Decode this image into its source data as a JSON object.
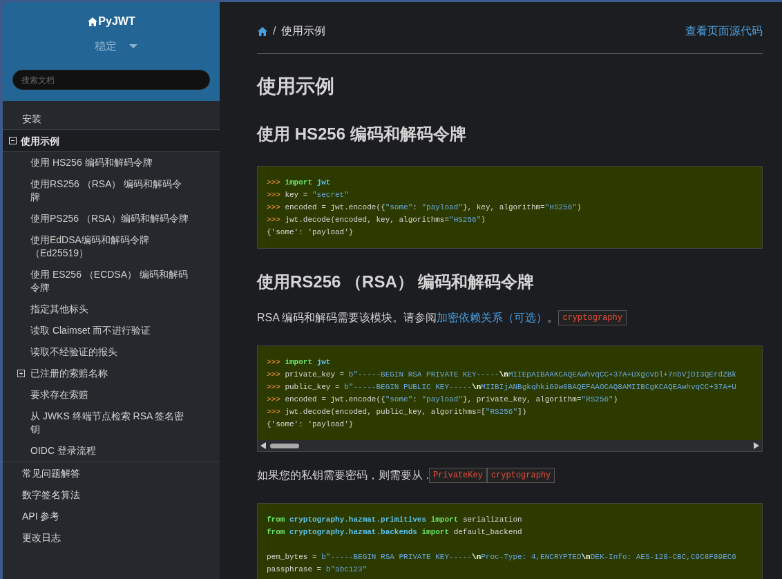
{
  "sidebar": {
    "project": "PyJWT",
    "version": "稳定",
    "search": {
      "placeholder": "搜索文档"
    },
    "items": [
      {
        "label": "安装",
        "selected": false
      },
      {
        "label": "使用示例",
        "selected": true,
        "expanded": true,
        "children": [
          {
            "label": "使用 HS256 编码和解码令牌"
          },
          {
            "label": "使用RS256 （RSA） 编码和解码令牌"
          },
          {
            "label": "使用PS256 （RSA）编码和解码令牌"
          },
          {
            "label": "使用EdDSA编码和解码令牌（Ed25519）"
          },
          {
            "label": "使用 ES256 （ECDSA） 编码和解码令牌"
          },
          {
            "label": "指定其他标头"
          },
          {
            "label": "读取 Claimset 而不进行验证"
          },
          {
            "label": "读取不经验证的报头"
          },
          {
            "label": "已注册的索赔名称",
            "expanded": false
          },
          {
            "label": "要求存在索赔"
          },
          {
            "label": "从 JWKS 终端节点检索 RSA 签名密钥"
          },
          {
            "label": "OIDC 登录流程"
          }
        ]
      },
      {
        "label": "常见问题解答",
        "selected": false
      },
      {
        "label": "数字签名算法",
        "selected": false
      },
      {
        "label": "API 参考",
        "selected": false
      },
      {
        "label": "更改日志",
        "selected": false
      }
    ]
  },
  "breadcrumb": {
    "separator": "/",
    "current": "使用示例",
    "source_link": "查看页面源代码"
  },
  "content": [
    {
      "kind": "h1",
      "text": "使用示例"
    },
    {
      "kind": "h2",
      "text": "使用 HS256 编码和解码令牌"
    },
    {
      "kind": "code",
      "scroll": false,
      "lines": [
        {
          "tokens": [
            {
              "kind": "prompt",
              "text": ">>> "
            },
            {
              "kind": "kw",
              "text": "import "
            },
            {
              "kind": "ns",
              "text": "jwt"
            }
          ]
        },
        {
          "tokens": [
            {
              "kind": "prompt",
              "text": ">>> "
            },
            {
              "kind": "plain",
              "text": "key = "
            },
            {
              "kind": "str",
              "text": "\"secret\""
            }
          ]
        },
        {
          "tokens": [
            {
              "kind": "prompt",
              "text": ">>> "
            },
            {
              "kind": "plain",
              "text": "encoded = jwt.encode({"
            },
            {
              "kind": "str",
              "text": "\"some\""
            },
            {
              "kind": "plain",
              "text": ": "
            },
            {
              "kind": "str",
              "text": "\"payload\""
            },
            {
              "kind": "plain",
              "text": "}, key, algorithm="
            },
            {
              "kind": "str",
              "text": "\"HS256\""
            },
            {
              "kind": "plain",
              "text": ")"
            }
          ]
        },
        {
          "tokens": [
            {
              "kind": "prompt",
              "text": ">>> "
            },
            {
              "kind": "plain",
              "text": "jwt.decode(encoded, key, algorithms="
            },
            {
              "kind": "str",
              "text": "\"HS256\""
            },
            {
              "kind": "plain",
              "text": ")"
            }
          ]
        },
        {
          "tokens": [
            {
              "kind": "plain",
              "text": "{'some': 'payload'}"
            }
          ]
        }
      ]
    },
    {
      "kind": "h2",
      "text": "使用RS256 （RSA） 编码和解码令牌"
    },
    {
      "kind": "para",
      "parts": [
        {
          "kind": "text",
          "text": "RSA 编码和解码需要该模块。请参阅 "
        },
        {
          "kind": "link",
          "text": "加密依赖关系（可选）"
        },
        {
          "kind": "text",
          "text": "。"
        },
        {
          "kind": "code",
          "text": "cryptography"
        }
      ]
    },
    {
      "kind": "code",
      "scroll": true,
      "lines": [
        {
          "tokens": [
            {
              "kind": "prompt",
              "text": ">>> "
            },
            {
              "kind": "kw",
              "text": "import "
            },
            {
              "kind": "ns",
              "text": "jwt"
            }
          ]
        },
        {
          "tokens": [
            {
              "kind": "prompt",
              "text": ">>> "
            },
            {
              "kind": "plain",
              "text": "private_key = "
            },
            {
              "kind": "str",
              "text": "b\"-----BEGIN RSA PRIVATE KEY-----"
            },
            {
              "kind": "esc",
              "text": "\\n"
            },
            {
              "kind": "str",
              "text": "MIIEpAIBAAKCAQEAwhvqCC+37A+UXgcvDl+7nbVjDI3QErdZBk"
            }
          ]
        },
        {
          "tokens": [
            {
              "kind": "prompt",
              "text": ">>> "
            },
            {
              "kind": "plain",
              "text": "public_key = "
            },
            {
              "kind": "str",
              "text": "b\"-----BEGIN PUBLIC KEY-----"
            },
            {
              "kind": "esc",
              "text": "\\n"
            },
            {
              "kind": "str",
              "text": "MIIBIjANBgkqhkiG9w0BAQEFAAOCAQ8AMIIBCgKCAQEAwhvqCC+37A+U"
            }
          ]
        },
        {
          "tokens": [
            {
              "kind": "prompt",
              "text": ">>> "
            },
            {
              "kind": "plain",
              "text": "encoded = jwt.encode({"
            },
            {
              "kind": "str",
              "text": "\"some\""
            },
            {
              "kind": "plain",
              "text": ": "
            },
            {
              "kind": "str",
              "text": "\"payload\""
            },
            {
              "kind": "plain",
              "text": "}, private_key, algorithm="
            },
            {
              "kind": "str",
              "text": "\"RS256\""
            },
            {
              "kind": "plain",
              "text": ")"
            }
          ]
        },
        {
          "tokens": [
            {
              "kind": "prompt",
              "text": ">>> "
            },
            {
              "kind": "plain",
              "text": "jwt.decode(encoded, public_key, algorithms=["
            },
            {
              "kind": "str",
              "text": "\"RS256\""
            },
            {
              "kind": "plain",
              "text": "])"
            }
          ]
        },
        {
          "tokens": [
            {
              "kind": "plain",
              "text": "{'some': 'payload'}"
            }
          ]
        }
      ]
    },
    {
      "kind": "para",
      "parts": [
        {
          "kind": "text",
          "text": "如果您的私钥需要密码，则需要从 ."
        },
        {
          "kind": "code",
          "text": "PrivateKey"
        },
        {
          "kind": "code",
          "text": "cryptography"
        }
      ]
    },
    {
      "kind": "code",
      "scroll": false,
      "lines": [
        {
          "tokens": [
            {
              "kind": "kw",
              "text": "from "
            },
            {
              "kind": "ns",
              "text": "cryptography.hazmat.primitives "
            },
            {
              "kind": "kw",
              "text": "import "
            },
            {
              "kind": "plain",
              "text": "serialization"
            }
          ]
        },
        {
          "tokens": [
            {
              "kind": "kw",
              "text": "from "
            },
            {
              "kind": "ns",
              "text": "cryptography.hazmat.backends "
            },
            {
              "kind": "kw",
              "text": "import "
            },
            {
              "kind": "plain",
              "text": "default_backend"
            }
          ]
        },
        {
          "gap_before": true,
          "tokens": [
            {
              "kind": "plain",
              "text": "pem_bytes = "
            },
            {
              "kind": "str",
              "text": "b\"-----BEGIN RSA PRIVATE KEY-----"
            },
            {
              "kind": "esc",
              "text": "\\n"
            },
            {
              "kind": "str",
              "text": "Proc-Type: 4,ENCRYPTED"
            },
            {
              "kind": "esc",
              "text": "\\n"
            },
            {
              "kind": "str",
              "text": "DEK-Info: AES-128-CBC,C9C8F89EC6"
            }
          ]
        },
        {
          "tokens": [
            {
              "kind": "plain",
              "text": "passphrase = "
            },
            {
              "kind": "str",
              "text": "b\"abc123\""
            }
          ]
        }
      ]
    }
  ]
}
